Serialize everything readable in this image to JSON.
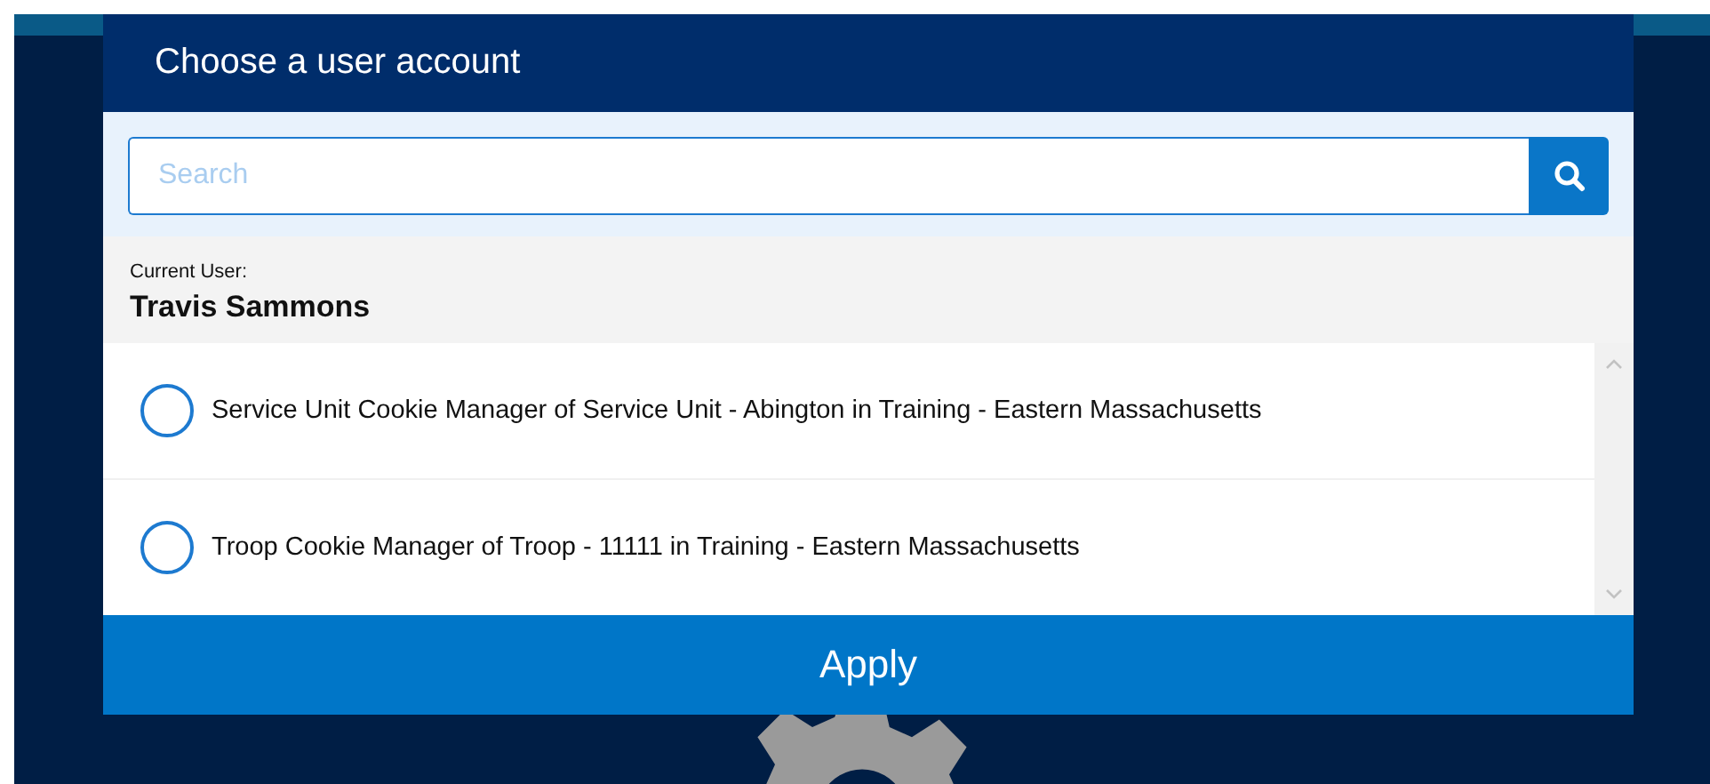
{
  "dialog": {
    "title": "Choose a user account"
  },
  "search": {
    "placeholder": "Search"
  },
  "current_user": {
    "label": "Current User:",
    "name": "Travis Sammons"
  },
  "accounts": [
    {
      "label": "Service Unit Cookie Manager of Service Unit - Abington in Training - Eastern Massachusetts",
      "selected": false
    },
    {
      "label": "Troop Cookie Manager of Troop - 11111 in Training - Eastern Massachusetts",
      "selected": false
    }
  ],
  "apply_button": "Apply"
}
